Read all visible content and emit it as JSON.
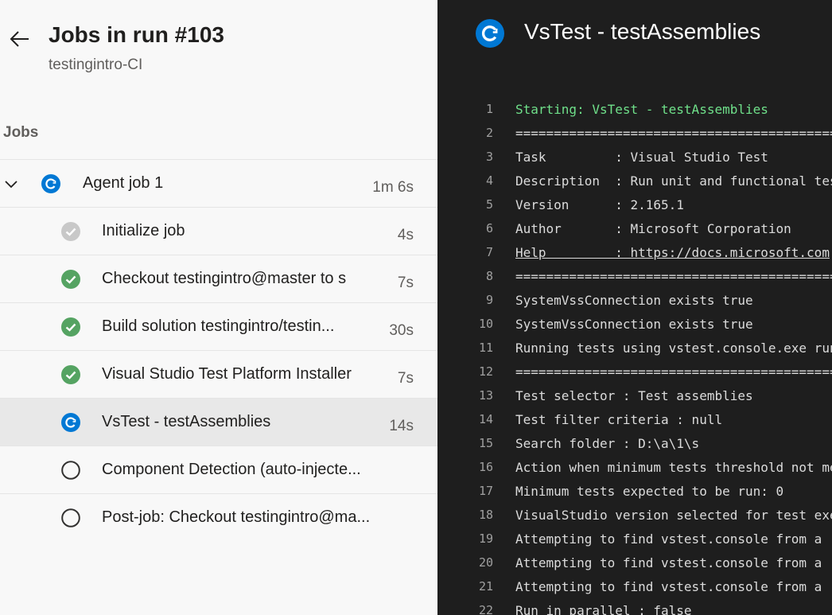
{
  "header": {
    "title": "Jobs in run #103",
    "subtitle": "testingintro-CI"
  },
  "jobs_label": "Jobs",
  "agent_job": {
    "label": "Agent job 1",
    "duration": "1m 6s",
    "status": "running"
  },
  "steps": [
    {
      "label": "Initialize job",
      "duration": "4s",
      "status": "skipped"
    },
    {
      "label": "Checkout testingintro@master to s",
      "duration": "7s",
      "status": "succeeded"
    },
    {
      "label": "Build solution testingintro/testin...",
      "duration": "30s",
      "status": "succeeded"
    },
    {
      "label": "Visual Studio Test Platform Installer",
      "duration": "7s",
      "status": "succeeded"
    },
    {
      "label": "VsTest - testAssemblies",
      "duration": "14s",
      "status": "running",
      "selected": true
    },
    {
      "label": "Component Detection (auto-injecte...",
      "duration": "",
      "status": "pending"
    },
    {
      "label": "Post-job: Checkout testingintro@ma...",
      "duration": "",
      "status": "pending"
    }
  ],
  "log": {
    "title": "VsTest - testAssemblies",
    "lines": [
      {
        "n": "1",
        "text": "Starting: VsTest - testAssemblies",
        "style": "green"
      },
      {
        "n": "2",
        "text": "==========================================================",
        "style": ""
      },
      {
        "n": "3",
        "text": "Task         : Visual Studio Test",
        "style": ""
      },
      {
        "n": "4",
        "text": "Description  : Run unit and functional tests",
        "style": ""
      },
      {
        "n": "5",
        "text": "Version      : 2.165.1",
        "style": ""
      },
      {
        "n": "6",
        "text": "Author       : Microsoft Corporation",
        "style": ""
      },
      {
        "n": "7",
        "text": "Help         : https://docs.microsoft.com",
        "style": "link"
      },
      {
        "n": "8",
        "text": "==========================================================",
        "style": ""
      },
      {
        "n": "9",
        "text": "SystemVssConnection exists true",
        "style": ""
      },
      {
        "n": "10",
        "text": "SystemVssConnection exists true",
        "style": ""
      },
      {
        "n": "11",
        "text": "Running tests using vstest.console.exe runner.",
        "style": ""
      },
      {
        "n": "12",
        "text": "==========================================================",
        "style": ""
      },
      {
        "n": "13",
        "text": "Test selector : Test assemblies",
        "style": ""
      },
      {
        "n": "14",
        "text": "Test filter criteria : null",
        "style": ""
      },
      {
        "n": "15",
        "text": "Search folder : D:\\a\\1\\s",
        "style": ""
      },
      {
        "n": "16",
        "text": "Action when minimum tests threshold not met",
        "style": ""
      },
      {
        "n": "17",
        "text": "Minimum tests expected to be run: 0",
        "style": ""
      },
      {
        "n": "18",
        "text": "VisualStudio version selected for test execution",
        "style": ""
      },
      {
        "n": "19",
        "text": "Attempting to find vstest.console from a",
        "style": ""
      },
      {
        "n": "20",
        "text": "Attempting to find vstest.console from a",
        "style": ""
      },
      {
        "n": "21",
        "text": "Attempting to find vstest.console from a",
        "style": ""
      },
      {
        "n": "22",
        "text": "Run in parallel : false",
        "style": ""
      }
    ]
  },
  "colors": {
    "running": "#0078d4",
    "succeeded": "#55a362",
    "skipped": "#c8c8c8",
    "pending": "#323130",
    "log_green": "#6fe08a"
  }
}
